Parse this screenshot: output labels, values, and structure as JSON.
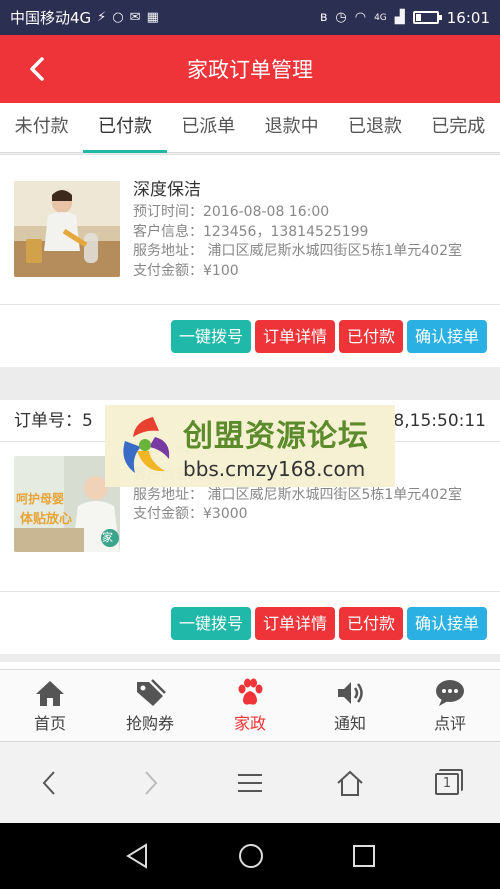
{
  "status_bar": {
    "carrier": "中国移动4G",
    "network": "4G",
    "time": "16:01"
  },
  "header": {
    "title": "家政订单管理",
    "back_icon": "chevron-left-icon"
  },
  "tabs": [
    {
      "label": "未付款"
    },
    {
      "label": "已付款",
      "active": true
    },
    {
      "label": "已派单"
    },
    {
      "label": "退款中"
    },
    {
      "label": "已退款"
    },
    {
      "label": "已完成"
    }
  ],
  "orders": [
    {
      "name": "深度保洁",
      "time_line": "预订时间：2016-08-08 16:00",
      "customer_line": "客户信息：123456，13814525199",
      "address_line": "服务地址： 浦口区威尼斯水城四街区5栋1单元402室",
      "amount_line": "支付金额：¥100"
    },
    {
      "order_no_prefix": "订单号：5",
      "order_time_suffix": "8,15:50:11",
      "time_line": "预订时间：2016-08-08 16:00",
      "customer_line": "客户信息：123456，13814525199",
      "address_line": "服务地址： 浦口区威尼斯水城四街区5栋1单元402室",
      "amount_line": "支付金额：¥3000",
      "image_text_1": "呵护母婴",
      "image_text_2": "体贴放心",
      "image_badge": "家"
    }
  ],
  "actions": {
    "call": "一键拨号",
    "details": "订单详情",
    "paid": "已付款",
    "confirm": "确认接单"
  },
  "watermark": {
    "title": "创盟资源论坛",
    "url": "bbs.cmzy168.com"
  },
  "bottom_nav": [
    {
      "label": "首页",
      "icon": "home-icon"
    },
    {
      "label": "抢购券",
      "icon": "tag-icon"
    },
    {
      "label": "家政",
      "icon": "paw-icon",
      "active": true
    },
    {
      "label": "通知",
      "icon": "speaker-icon"
    },
    {
      "label": "点评",
      "icon": "chat-icon"
    }
  ],
  "browser_bar": {
    "back": "back-arrow-icon",
    "forward": "forward-arrow-icon",
    "menu": "menu-icon",
    "home": "home-outline-icon",
    "tabs_count": "1"
  },
  "colors": {
    "primary": "#ee3438",
    "teal": "#20b8a8",
    "blue": "#2bb0e3",
    "status_bar": "#2b2f52"
  }
}
